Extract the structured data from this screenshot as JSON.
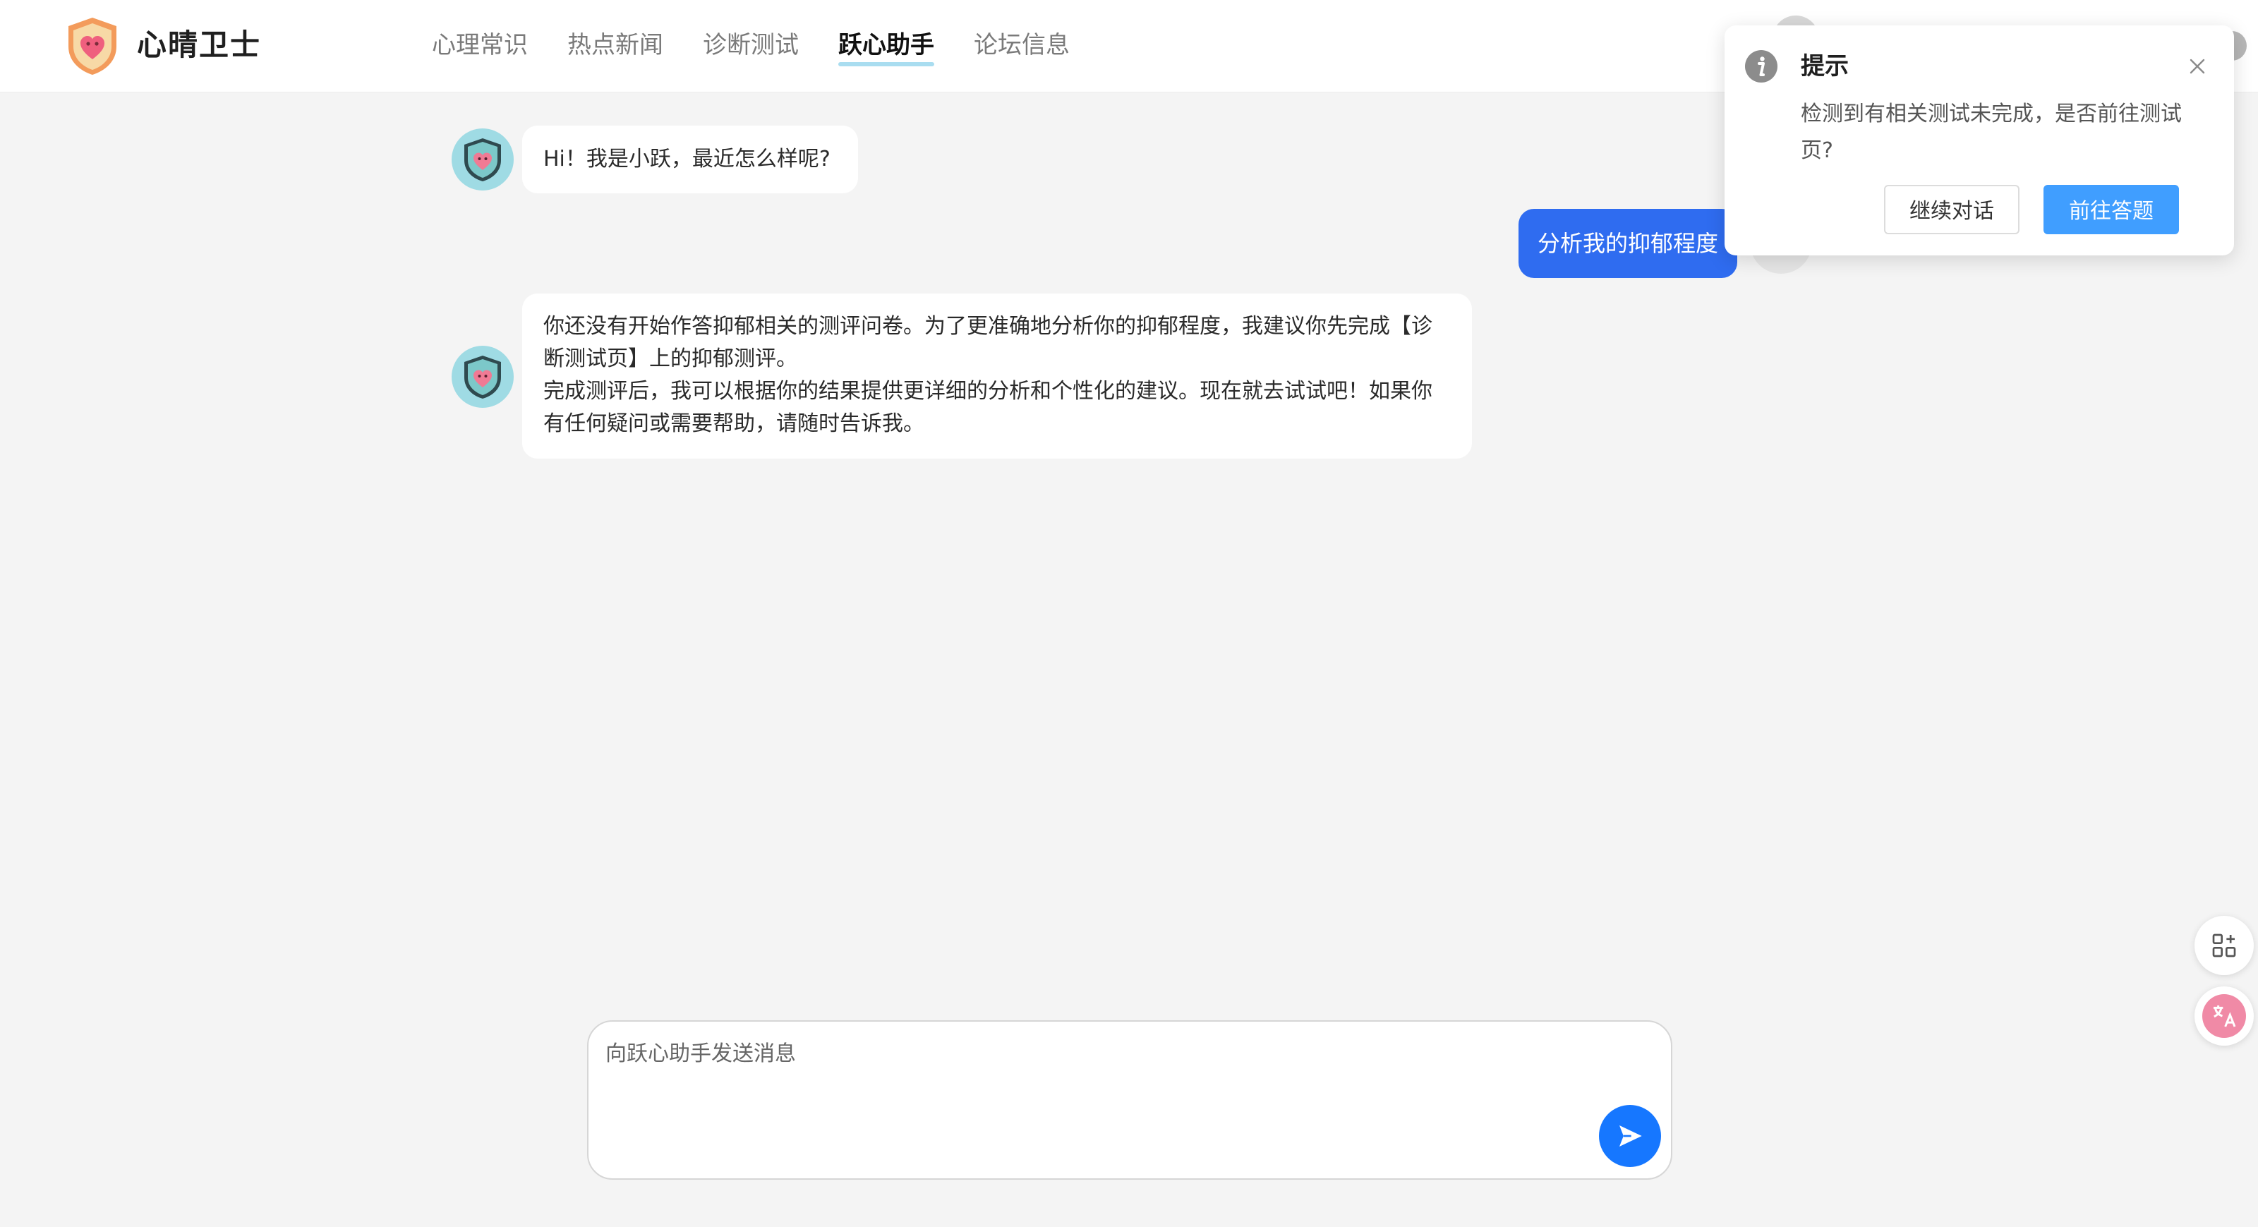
{
  "brand": {
    "name": "心晴卫士"
  },
  "nav": {
    "items": [
      {
        "label": "心理常识"
      },
      {
        "label": "热点新闻"
      },
      {
        "label": "诊断测试"
      },
      {
        "label": "跃心助手"
      },
      {
        "label": "论坛信息"
      }
    ],
    "active_index": 3
  },
  "chat": {
    "messages": [
      {
        "role": "bot",
        "text": "Hi！我是小跃，最近怎么样呢?"
      },
      {
        "role": "user",
        "text": "分析我的抑郁程度"
      },
      {
        "role": "bot",
        "lines": [
          "你还没有开始作答抑郁相关的测评问卷。为了更准确地分析你的抑郁程度，我建议你先完成【诊断测试页】上的抑郁测评。",
          "完成测评后，我可以根据你的结果提供更详细的分析和个性化的建议。现在就去试试吧！如果你有任何疑问或需要帮助，请随时告诉我。"
        ]
      }
    ]
  },
  "input": {
    "placeholder": "向跃心助手发送消息",
    "value": ""
  },
  "dialog": {
    "title": "提示",
    "message": "检测到有相关测试未完成，是否前往测试页?",
    "cancel_label": "继续对话",
    "confirm_label": "前往答题"
  },
  "icons": {
    "logo": "shield-heart-logo",
    "bot_avatar": "shield-heart-avatar",
    "send": "send-icon",
    "info": "info-icon",
    "close": "close-icon",
    "apps": "apps-icon",
    "translate": "translate-icon"
  },
  "colors": {
    "accent": "#2f6cf0",
    "send": "#1677ff",
    "confirm": "#409eff",
    "nav_underline": "#a9ddf0",
    "avatar_bg": "#9fdbe4"
  }
}
